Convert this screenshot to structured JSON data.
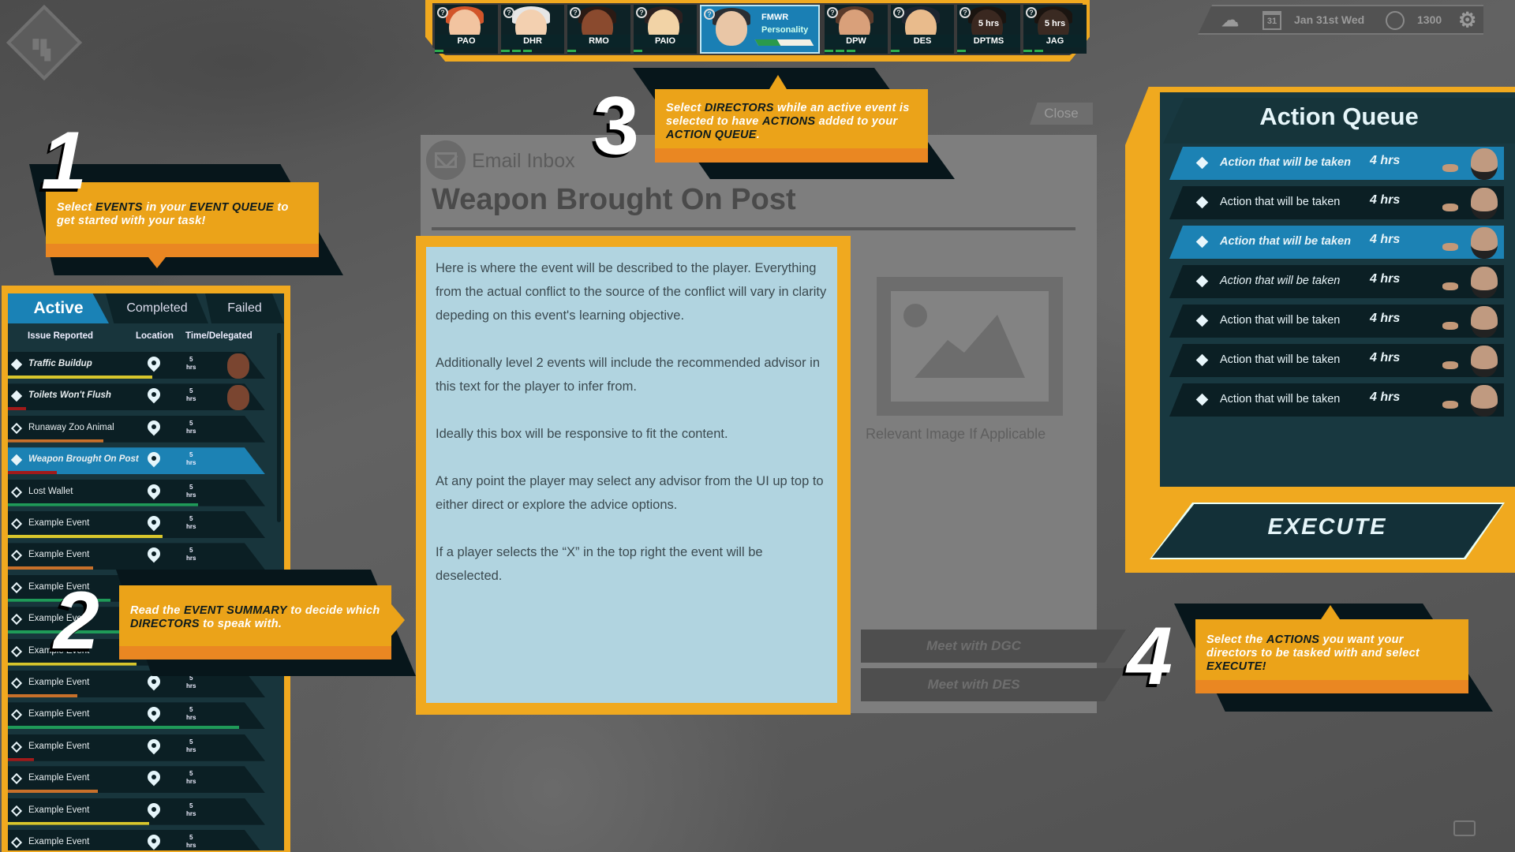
{
  "top_status": {
    "date": "Jan 31st Wed",
    "calendar_day": "31",
    "time": "1300",
    "icons": [
      "weather-icon",
      "calendar-icon",
      "clock-icon",
      "settings-icon"
    ]
  },
  "directors": [
    {
      "code": "PAO",
      "skin": "#f2c4a0",
      "hair": "#d2552a",
      "segments": 1
    },
    {
      "code": "DHR",
      "skin": "#f3d0b0",
      "hair": "#e6e6e6",
      "segments": 3
    },
    {
      "code": "RMO",
      "skin": "#8a4a2e",
      "hair": "#2a1a14",
      "segments": 1
    },
    {
      "code": "PAIO",
      "skin": "#f2d3a6",
      "hair": "#2b2020",
      "segments": 1
    },
    {
      "code": "FMWR",
      "subtitle": "Personality",
      "selected": true,
      "skin": "#e9c6a6",
      "hair": "#2a2e33",
      "progress": 0.4
    },
    {
      "code": "DPW",
      "skin": "#d9a07a",
      "hair": "#5a3a2a",
      "segments": 3
    },
    {
      "code": "DES",
      "skin": "#e9bb8c",
      "hair": "#1d2530",
      "segments": 1
    },
    {
      "code": "DPTMS",
      "time": "5 hrs",
      "skin": "#3a2820",
      "hair": "#1a1410",
      "segments": 1
    },
    {
      "code": "JAG",
      "time": "5 hrs",
      "skin": "#3a2a22",
      "hair": "#1a1410",
      "segments": 2
    }
  ],
  "callouts": {
    "c1": {
      "number": "1",
      "segments": [
        {
          "t": "Select "
        },
        {
          "t": "EVENTS",
          "em": true
        },
        {
          "t": " in your "
        },
        {
          "t": "EVENT QUEUE",
          "em": true
        },
        {
          "t": " to get started with your task!"
        }
      ]
    },
    "c2": {
      "number": "2",
      "segments": [
        {
          "t": "Read the "
        },
        {
          "t": "EVENT SUMMARY",
          "em": true
        },
        {
          "t": " to decide which "
        },
        {
          "t": "DIRECTORS",
          "em": true
        },
        {
          "t": " to speak with."
        }
      ]
    },
    "c3": {
      "number": "3",
      "segments": [
        {
          "t": "Select "
        },
        {
          "t": "DIRECTORS",
          "em": true
        },
        {
          "t": " while an active event is selected to have "
        },
        {
          "t": "ACTIONS",
          "em": true
        },
        {
          "t": " added to your "
        },
        {
          "t": "ACTION QUEUE",
          "em": true
        },
        {
          "t": "."
        }
      ]
    },
    "c4": {
      "number": "4",
      "segments": [
        {
          "t": "Select the "
        },
        {
          "t": "ACTIONS",
          "em": true
        },
        {
          "t": " you want your directors to be tasked with and select "
        },
        {
          "t": "EXECUTE!",
          "em": true
        }
      ]
    }
  },
  "event_panel": {
    "tabs": {
      "active": "Active",
      "completed": "Completed",
      "failed": "Failed"
    },
    "columns": {
      "issue": "Issue Reported",
      "location": "Location",
      "time": "Time/Delegated"
    },
    "events": [
      {
        "name": "Traffic Buildup",
        "time": "5",
        "unit": "hrs",
        "bar": "#d8c62c",
        "progress": 0.56,
        "bold": true,
        "delegated": true
      },
      {
        "name": "Toilets Won't Flush",
        "time": "5",
        "unit": "hrs",
        "bar": "#a11a1a",
        "progress": 0.07,
        "bold": true,
        "delegated": true
      },
      {
        "name": "Runaway Zoo Animal",
        "time": "5",
        "unit": "hrs",
        "bar": "#c8702a",
        "progress": 0.37
      },
      {
        "name": "Weapon Brought On Post",
        "time": "5",
        "unit": "hrs",
        "bar": "#a11a1a",
        "progress": 0.19,
        "bold": true,
        "selected": true
      },
      {
        "name": "Lost Wallet",
        "time": "5",
        "unit": "hrs",
        "bar": "#1f9a58",
        "progress": 0.74
      },
      {
        "name": "Example Event",
        "time": "5",
        "unit": "hrs",
        "bar": "#d8c62c",
        "progress": 0.6
      },
      {
        "name": "Example Event",
        "time": "5",
        "unit": "hrs",
        "bar": "#c8702a",
        "progress": 0.33
      },
      {
        "name": "Example Event",
        "time": "5",
        "unit": "hrs",
        "bar": "#1f9a58",
        "progress": 0.4
      },
      {
        "name": "Example Event",
        "time": "5",
        "unit": "hrs",
        "bar": "#1f9a58",
        "progress": 0.45
      },
      {
        "name": "Example Event",
        "time": "5",
        "unit": "hrs",
        "bar": "#d8c62c",
        "progress": 0.5
      },
      {
        "name": "Example Event",
        "time": "5",
        "unit": "hrs",
        "bar": "#c8702a",
        "progress": 0.27
      },
      {
        "name": "Example Event",
        "time": "5",
        "unit": "hrs",
        "bar": "#1f9a58",
        "progress": 0.9
      },
      {
        "name": "Example Event",
        "time": "5",
        "unit": "hrs",
        "bar": "#a11a1a",
        "progress": 0.1
      },
      {
        "name": "Example Event",
        "time": "5",
        "unit": "hrs",
        "bar": "#c8702a",
        "progress": 0.35
      },
      {
        "name": "Example Event",
        "time": "5",
        "unit": "hrs",
        "bar": "#d8c62c",
        "progress": 0.55
      },
      {
        "name": "Example Event",
        "time": "5",
        "unit": "hrs",
        "bar": "#1f9a58",
        "progress": 0.78
      }
    ]
  },
  "email": {
    "close_label": "Close",
    "inbox_label": "Email Inbox",
    "title": "Weapon Brought On Post",
    "paragraphs": [
      "Here is where the event will be described to the player. Everything from the actual conflict to the source of the conflict will vary in clarity depeding on this event's learning objective.",
      "Additionally level 2 events will include the recommended advisor in this text for the player to infer from.",
      "Ideally this box will be responsive to fit the content.",
      "At any point the player may select any advisor from the UI up top to either direct or explore the advice options.",
      "If a player selects the “X” in the top right the event will be deselected."
    ],
    "image_caption": "Relevant Image If Applicable",
    "meet_buttons": [
      "Meet with DGC",
      "Meet with DES"
    ]
  },
  "action_queue": {
    "title": "Action Queue",
    "actions": [
      {
        "label": "Action that will be taken",
        "time": "4 hrs",
        "style": "highlight"
      },
      {
        "label": "Action that will be taken",
        "time": "4 hrs",
        "style": "normal"
      },
      {
        "label": "Action that will be taken",
        "time": "4 hrs",
        "style": "highlight"
      },
      {
        "label": "Action that will be taken",
        "time": "4 hrs",
        "style": "italic"
      },
      {
        "label": "Action that will be taken",
        "time": "4 hrs",
        "style": "normal"
      },
      {
        "label": "Action that will be taken",
        "time": "4 hrs",
        "style": "normal"
      },
      {
        "label": "Action that will be taken",
        "time": "4 hrs",
        "style": "normal"
      }
    ],
    "execute_label": "EXECUTE"
  },
  "colors": {
    "accent_orange": "#f0a91f",
    "panel_teal": "#18353c",
    "selected_blue": "#1c82b4"
  }
}
